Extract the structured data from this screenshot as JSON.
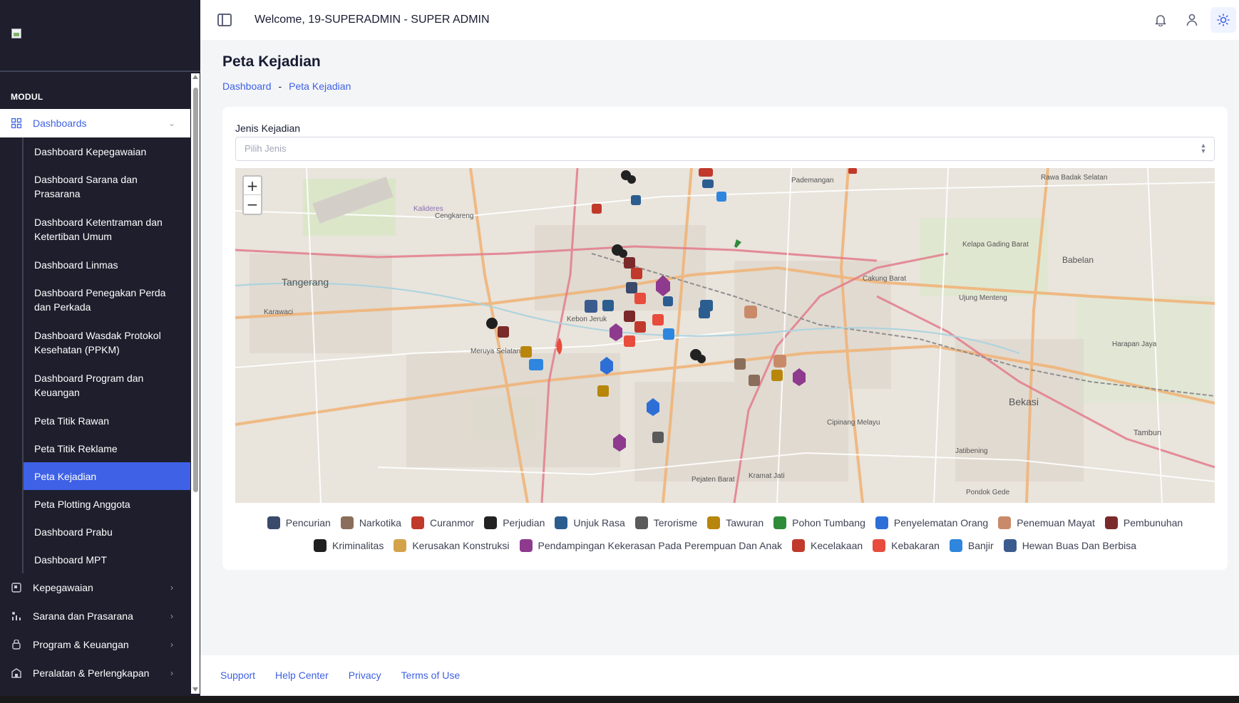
{
  "header": {
    "welcome": "Welcome, 19-SUPERADMIN - SUPER ADMIN"
  },
  "sidebar": {
    "section_label": "MODUL",
    "dashboards_label": "Dashboards",
    "sub_items": [
      "Dashboard Kepegawaian",
      "Dashboard Sarana dan Prasarana",
      "Dashboard Ketentraman dan Ketertiban Umum",
      "Dashboard Linmas",
      "Dashboard Penegakan Perda dan Perkada",
      "Dashboard Wasdak Protokol Kesehatan (PPKM)",
      "Dashboard Program dan Keuangan",
      "Peta Titik Rawan",
      "Peta Titik Reklame",
      "Peta Kejadian",
      "Peta Plotting Anggota",
      "Dashboard Prabu",
      "Dashboard MPT"
    ],
    "modules": [
      "Kepegawaian",
      "Sarana dan Prasarana",
      "Program & Keuangan",
      "Peralatan & Perlengkapan"
    ]
  },
  "page": {
    "title": "Peta Kejadian",
    "breadcrumb": [
      "Dashboard",
      "-",
      "Peta Kejadian"
    ]
  },
  "filter": {
    "label": "Jenis Kejadian",
    "placeholder": "Pilih Jenis"
  },
  "map": {
    "zoom_in": "+",
    "zoom_out": "−",
    "places": [
      "Tangerang",
      "Bekasi",
      "Babelan",
      "Karawaci",
      "Cengkareng",
      "Kebon Jeruk",
      "Cakung Barat",
      "Ujung Menteng",
      "Tambun",
      "Pondok Gede",
      "Jatibening",
      "Rawa Badak Selatan",
      "Kelapa Gading Barat",
      "Pademangan",
      "Kalideres",
      "Meruya Selatan",
      "Cipinang Melayu",
      "Harapan Jaya",
      "Pejaten Barat",
      "Kramat Jati"
    ]
  },
  "legend": {
    "row1": [
      "Pencurian",
      "Narkotika",
      "Curanmor",
      "Perjudian",
      "Unjuk Rasa",
      "Terorisme",
      "Tawuran",
      "Pohon Tumbang",
      "Penyelematan Orang",
      "Penemuan Mayat",
      "Pembunuhan"
    ],
    "row2": [
      "Kriminalitas",
      "Kerusakan Konstruksi",
      "Pendampingan Kekerasan Pada Perempuan Dan Anak",
      "Kecelakaan",
      "Kebakaran",
      "Banjir",
      "Hewan Buas Dan Berbisa"
    ],
    "colors": {
      "Pencurian": "#3a4a6b",
      "Narkotika": "#8a6d5a",
      "Curanmor": "#c0392b",
      "Perjudian": "#222222",
      "Unjuk Rasa": "#2c5d8f",
      "Terorisme": "#5a5a5a",
      "Tawuran": "#b8860b",
      "Pohon Tumbang": "#2e8b3a",
      "Penyelematan Orang": "#2d6fd6",
      "Penemuan Mayat": "#c98a6a",
      "Pembunuhan": "#7a2a2a",
      "Kriminalitas": "#1f1f1f",
      "Kerusakan Konstruksi": "#d4a24a",
      "Pendampingan Kekerasan Pada Perempuan Dan Anak": "#8e3a8e",
      "Kecelakaan": "#c0392b",
      "Kebakaran": "#e74c3c",
      "Banjir": "#2e86de",
      "Hewan Buas Dan Berbisa": "#3b5b8f"
    }
  },
  "footer": {
    "links": [
      "Support",
      "Help Center",
      "Privacy",
      "Terms of Use"
    ]
  }
}
